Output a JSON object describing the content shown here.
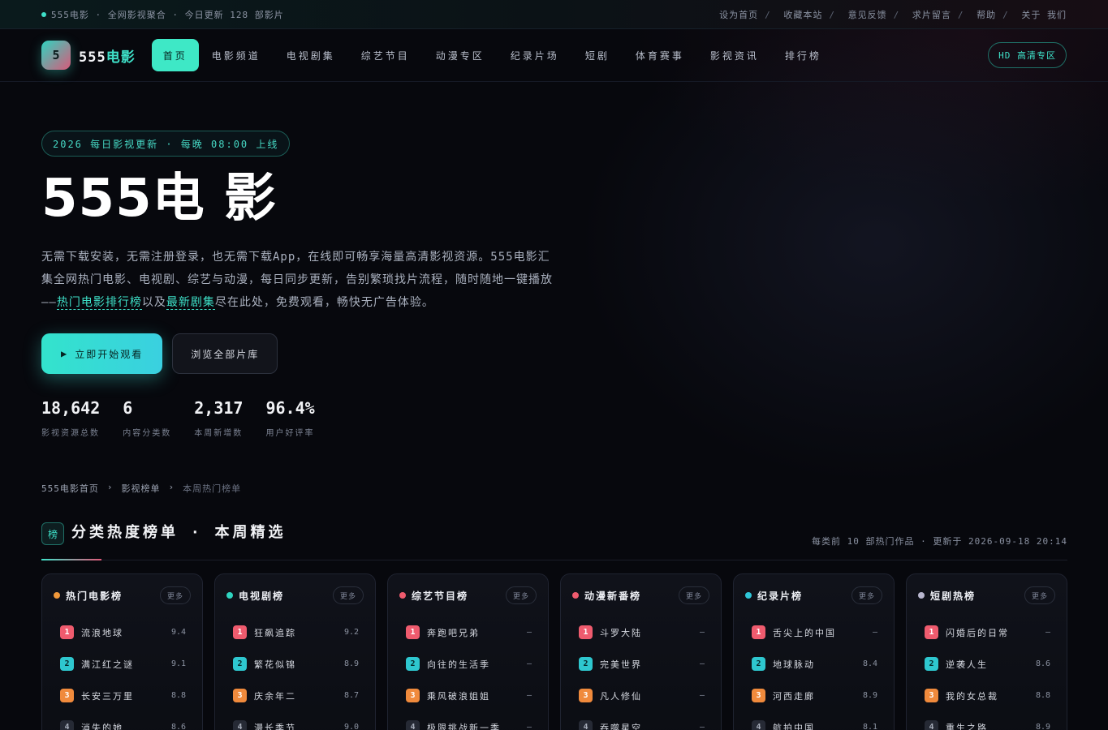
{
  "topbar": {
    "site_status": "555电影 · 全网影视聚合 · 今日更新 128 部影片",
    "links": [
      "设为首页",
      "收藏本站",
      "意见反馈",
      "求片留言",
      "帮助",
      "关于 我们"
    ]
  },
  "nav": {
    "logo_mark": "5",
    "logo_name": "555",
    "logo_suffix": "电影",
    "items": [
      "首页",
      "电影频道",
      "电视剧集",
      "综艺节目",
      "动漫专区",
      "纪录片场",
      "短剧",
      "体育赛事",
      "影视资讯",
      "排行榜"
    ],
    "hd_label": "HD 高清专区"
  },
  "hero": {
    "pill": "2026 每日影视更新 · 每晚 08:00 上线",
    "title": "555电 影",
    "desc_part1": "无需下载安装，无需注册登录，也无需下载App，在线即可畅享海量高清影视资源。555电影汇集全网热门电影、电视剧、综艺与动漫，每日同步更新，告别繁琐找片流程，随时随地一键播放——",
    "desc_link1": "热门电影排行榜",
    "desc_mid": "以及",
    "desc_link2": "最新剧集",
    "desc_part2": "尽在此处，免费观看，畅快无广告体验。",
    "btn_primary": "立即开始观看",
    "btn_primary_icon": "▶",
    "btn_secondary": "浏览全部片库",
    "stats": [
      {
        "value": "18,642",
        "label": "影视资源总数"
      },
      {
        "value": "6",
        "label": "内容分类数"
      },
      {
        "value": "2,317",
        "label": "本周新增数"
      },
      {
        "value": "96.4%",
        "label": "用户好评率"
      }
    ]
  },
  "breadcrumb": [
    "555电影首页",
    "影视榜单",
    "本周热门榜单"
  ],
  "section": {
    "icon": "榜",
    "title": "分类热度榜单 · 本周精选",
    "meta_prefix": "每类前 10 部热门作品",
    "meta_update": "更新于",
    "meta_time": "2026-09-18 20:14"
  },
  "cards": [
    {
      "title": "热门电影榜",
      "dot": "#f0983a",
      "more": "更多",
      "rows": [
        {
          "title": "流浪地球",
          "score": "9.4"
        },
        {
          "title": "满江红之谜",
          "score": "9.1"
        },
        {
          "title": "长安三万里",
          "score": "8.8"
        },
        {
          "title": "消失的她",
          "score": "8.6"
        }
      ]
    },
    {
      "title": "电视剧榜",
      "dot": "#2fd4c0",
      "more": "更多",
      "rows": [
        {
          "title": "狂飙追踪",
          "score": "9.2"
        },
        {
          "title": "繁花似锦",
          "score": "8.9"
        },
        {
          "title": "庆余年二",
          "score": "8.7"
        },
        {
          "title": "漫长季节",
          "score": "9.0"
        }
      ]
    },
    {
      "title": "综艺节目榜",
      "dot": "#ef5b6e",
      "more": "更多",
      "rows": [
        {
          "title": "奔跑吧兄弟",
          "score": "—"
        },
        {
          "title": "向往的生活季",
          "score": "—"
        },
        {
          "title": "乘风破浪姐姐",
          "score": "—"
        },
        {
          "title": "极限挑战新一季",
          "score": "—"
        }
      ]
    },
    {
      "title": "动漫新番榜",
      "dot": "#ef5b6e",
      "more": "更多",
      "rows": [
        {
          "title": "斗罗大陆",
          "score": "—"
        },
        {
          "title": "完美世界",
          "score": "—"
        },
        {
          "title": "凡人修仙",
          "score": "—"
        },
        {
          "title": "吞噬星空",
          "score": "—"
        }
      ]
    },
    {
      "title": "纪录片榜",
      "dot": "#2fc7d8",
      "more": "更多",
      "rows": [
        {
          "title": "舌尖上的中国",
          "score": "—"
        },
        {
          "title": "地球脉动",
          "score": "8.4"
        },
        {
          "title": "河西走廊",
          "score": "8.9"
        },
        {
          "title": "航拍中国",
          "score": "8.1"
        }
      ]
    },
    {
      "title": "短剧热榜",
      "dot": "#b9b7cf",
      "more": "更多",
      "rows": [
        {
          "title": "闪婚后的日常",
          "score": "—"
        },
        {
          "title": "逆袭人生",
          "score": "8.6"
        },
        {
          "title": "我的女总裁",
          "score": "8.8"
        },
        {
          "title": "重生之路",
          "score": "8.9"
        }
      ]
    }
  ]
}
